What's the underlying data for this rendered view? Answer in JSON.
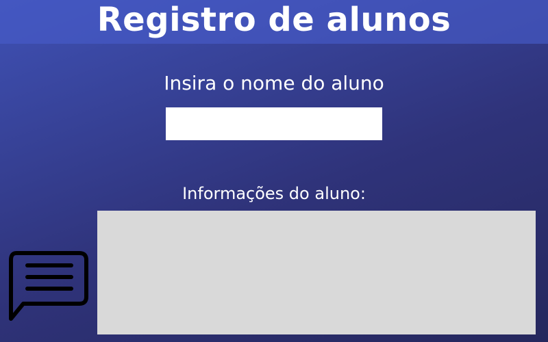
{
  "header": {
    "title": "Registro de alunos"
  },
  "form": {
    "name_label": "Insira o nome do aluno",
    "name_input": {
      "value": "",
      "placeholder": ""
    }
  },
  "info": {
    "label": "Informações do aluno:"
  },
  "icons": {
    "message": "chat-bubble-icon"
  },
  "colors": {
    "background_top": "#3f51b5",
    "background_bottom": "#25275d",
    "header_band": "#465ac8",
    "panel": "#d9d9d9",
    "input": "#ffffff",
    "text": "#ffffff",
    "icon_outline": "#000000"
  }
}
